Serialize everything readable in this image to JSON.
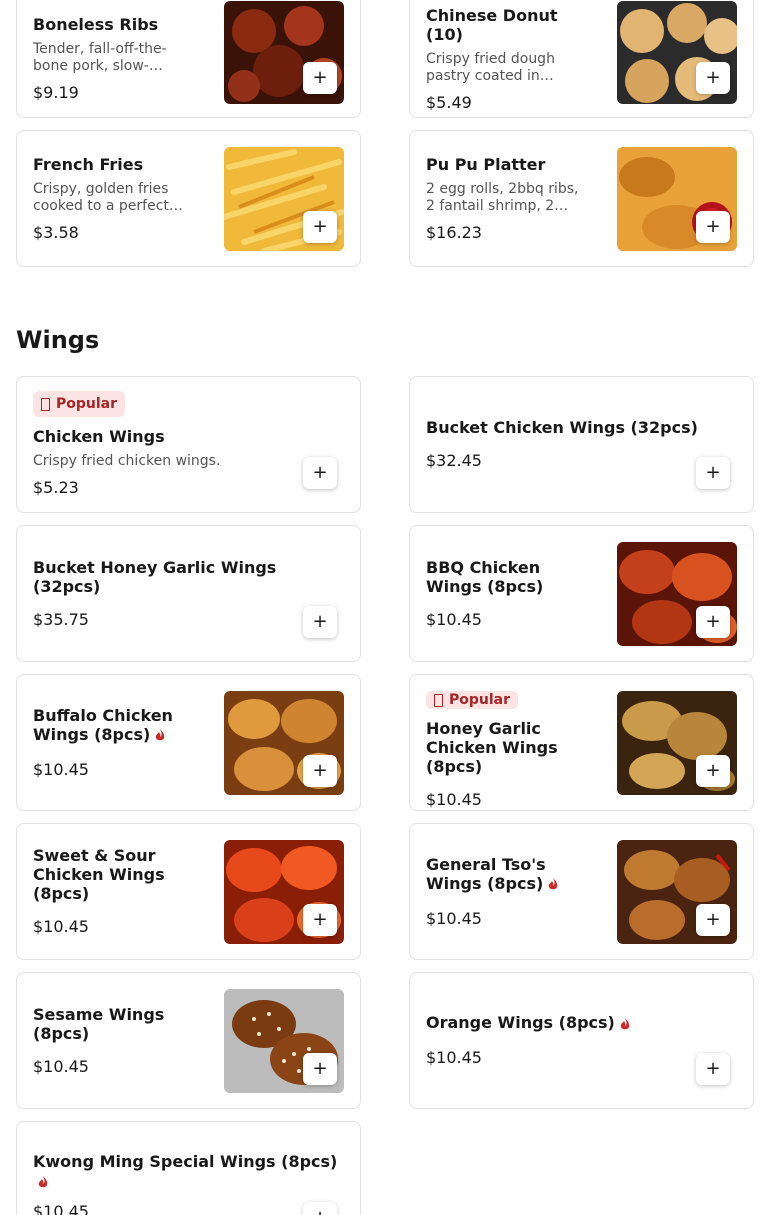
{
  "menu": {
    "top_items": [
      {
        "name": "Boneless Ribs",
        "description": "Tender, fall-off-the-bone pork, slow-…",
        "price": "$9.19",
        "add_label": "+"
      },
      {
        "name": "Chinese Donut (10)",
        "description": "Crispy fried dough pastry coated in…",
        "price": "$5.49",
        "add_label": "+"
      },
      {
        "name": "French Fries",
        "description": "Crispy, golden fries cooked to a perfect…",
        "price": "$3.58",
        "add_label": "+"
      },
      {
        "name": "Pu Pu Platter",
        "description": "2 egg rolls, 2bbq ribs, 2 fantail shrimp, 2…",
        "price": "$16.23",
        "add_label": "+"
      }
    ],
    "wings_section": {
      "title": "Wings",
      "popular_badge": "Popular",
      "items": [
        {
          "name": "Chicken Wings",
          "description": "Crispy fried chicken wings.",
          "price": "$5.23",
          "popular": true,
          "spicy": false,
          "add_label": "+"
        },
        {
          "name": "Bucket Chicken Wings (32pcs)",
          "price": "$32.45",
          "popular": false,
          "spicy": false,
          "add_label": "+"
        },
        {
          "name": "Bucket Honey Garlic Wings (32pcs)",
          "price": "$35.75",
          "popular": false,
          "spicy": false,
          "add_label": "+"
        },
        {
          "name": "BBQ Chicken Wings (8pcs)",
          "price": "$10.45",
          "popular": false,
          "spicy": false,
          "add_label": "+"
        },
        {
          "name": "Buffalo Chicken Wings (8pcs)",
          "price": "$10.45",
          "popular": false,
          "spicy": true,
          "add_label": "+"
        },
        {
          "name": "Honey Garlic Chicken Wings (8pcs)",
          "price": "$10.45",
          "popular": true,
          "spicy": false,
          "add_label": "+"
        },
        {
          "name": "Sweet & Sour Chicken Wings (8pcs)",
          "price": "$10.45",
          "popular": false,
          "spicy": false,
          "add_label": "+"
        },
        {
          "name": "General Tso's Wings (8pcs)",
          "price": "$10.45",
          "popular": false,
          "spicy": true,
          "add_label": "+"
        },
        {
          "name": "Sesame Wings (8pcs)",
          "price": "$10.45",
          "popular": false,
          "spicy": false,
          "add_label": "+"
        },
        {
          "name": "Orange Wings (8pcs)",
          "price": "$10.45",
          "popular": false,
          "spicy": true,
          "add_label": "+"
        },
        {
          "name": "Kwong Ming Special Wings (8pcs)",
          "price": "$10.45",
          "popular": false,
          "spicy": true,
          "add_label": "+"
        }
      ]
    }
  },
  "icons": {
    "add": "plus-icon",
    "spicy": "chili-pepper-icon",
    "popular": "popular-badge-icon"
  },
  "colors": {
    "badge_bg": "#fde4e4",
    "badge_text": "#a32626",
    "spicy": "#c92a2a",
    "border": "#e2e2e2"
  }
}
